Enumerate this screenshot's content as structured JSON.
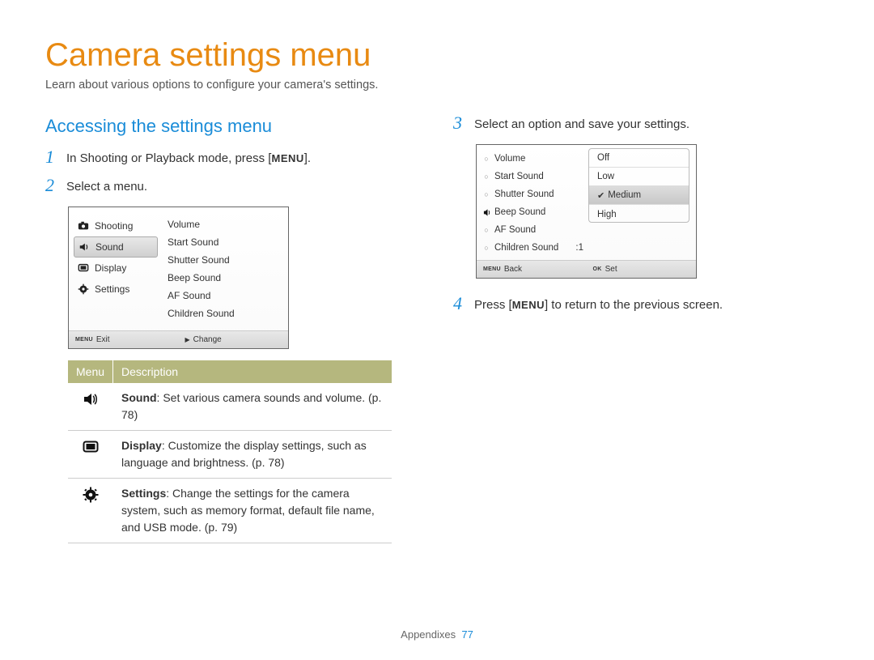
{
  "title": "Camera settings menu",
  "subtitle": "Learn about various options to configure your camera's settings.",
  "section_title": "Accessing the settings menu",
  "steps": {
    "s1": {
      "num": "1",
      "pre": "In Shooting or Playback mode, press [",
      "btn": "MENU",
      "post": "]."
    },
    "s2": {
      "num": "2",
      "text": "Select a menu."
    },
    "s3": {
      "num": "3",
      "text": "Select an option and save your settings."
    },
    "s4": {
      "num": "4",
      "pre": "Press [",
      "btn": "MENU",
      "post": "] to return to the previous screen."
    }
  },
  "shot1": {
    "left": {
      "shooting": "Shooting",
      "sound": "Sound",
      "display": "Display",
      "settings": "Settings"
    },
    "right": {
      "volume": "Volume",
      "start_sound": "Start Sound",
      "shutter_sound": "Shutter Sound",
      "beep_sound": "Beep Sound",
      "af_sound": "AF Sound",
      "children_sound": "Children Sound"
    },
    "footer": {
      "menu_tag": "MENU",
      "exit": "Exit",
      "arrow": "▶",
      "change": "Change"
    }
  },
  "menu_table": {
    "head": {
      "menu": "Menu",
      "desc": "Description"
    },
    "rows": {
      "sound": {
        "bold": "Sound",
        "rest": ": Set various camera sounds and volume. (p. 78)"
      },
      "display": {
        "bold": "Display",
        "rest": ": Customize the display settings, such as language and brightness. (p. 78)"
      },
      "settings": {
        "bold": "Settings",
        "rest": ": Change the settings for the camera system, such as memory format, default file name, and USB mode. (p. 79)"
      }
    }
  },
  "shot2": {
    "left": {
      "volume": "Volume",
      "start_sound": "Start Sound",
      "shutter_sound": "Shutter Sound",
      "beep_sound": "Beep Sound",
      "af_sound": "AF Sound",
      "children_sound": "Children Sound",
      "children_val": ":1"
    },
    "right": {
      "off": "Off",
      "low": "Low",
      "medium": "Medium",
      "high": "High"
    },
    "footer": {
      "menu_tag": "MENU",
      "back": "Back",
      "ok_tag": "OK",
      "set": "Set"
    }
  },
  "footer": {
    "section": "Appendixes",
    "page": "77"
  }
}
